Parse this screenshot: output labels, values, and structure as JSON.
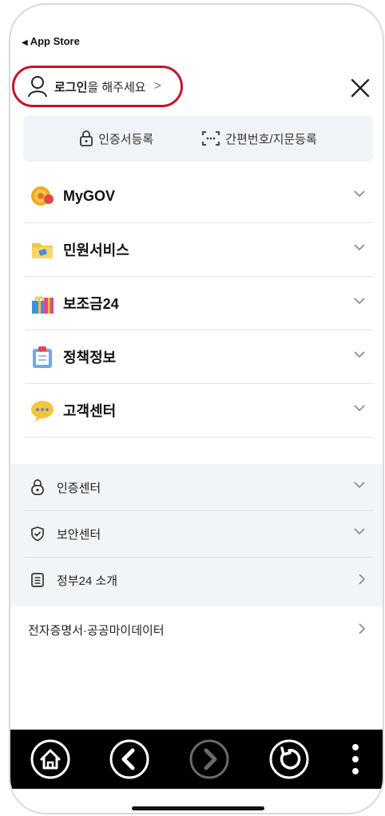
{
  "status": {
    "back_label": "App Store"
  },
  "login": {
    "bold": "로그인",
    "rest": "을 해주세요",
    "chevron": ">"
  },
  "cert": {
    "cert_register": "인증서등록",
    "simple_register": "간편번호/지문등록"
  },
  "menu": [
    {
      "label": "MyGOV",
      "icon": "gear-icon"
    },
    {
      "label": "민원서비스",
      "icon": "folder-icon"
    },
    {
      "label": "보조금24",
      "icon": "gift-icon"
    },
    {
      "label": "정책정보",
      "icon": "clipboard-icon"
    },
    {
      "label": "고객센터",
      "icon": "chat-bubble-icon"
    }
  ],
  "sub": [
    {
      "label": "인증센터",
      "icon": "lock-icon"
    },
    {
      "label": "보안센터",
      "icon": "shield-icon"
    },
    {
      "label": "정부24 소개",
      "icon": "document-icon"
    }
  ],
  "extra": {
    "label": "전자증명서·공공마이데이터"
  },
  "colors": {
    "login_border": "#c5132a",
    "cert_bg": "#f0f3f7",
    "sub_bg": "#f2f5f8",
    "nav_bg": "#000000"
  },
  "nav": [
    {
      "icon": "home-icon"
    },
    {
      "icon": "back-icon"
    },
    {
      "icon": "forward-icon"
    },
    {
      "icon": "refresh-icon"
    },
    {
      "icon": "more-icon"
    }
  ]
}
